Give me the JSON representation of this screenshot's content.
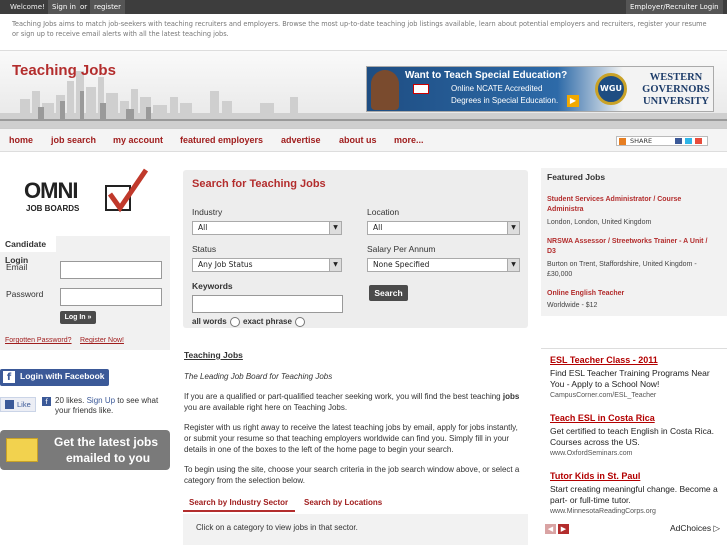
{
  "topbar": {
    "welcome": "Welcome!",
    "sign_in": "Sign in",
    "or": "or",
    "register": "register",
    "employer_login": "Employer/Recruiter Login"
  },
  "intro": "Teaching Jobs aims to match job-seekers with teaching recruiters and employers. Browse the most up-to-date teaching job listings available, learn about potential employers and recruiters, register your resume or sign up to receive email alerts with all the latest teaching jobs.",
  "header": {
    "title": "Teaching Jobs"
  },
  "banner": {
    "headline": "Want to Teach Special Education?",
    "line1": "Online NCATE Accredited",
    "line2": "Degrees in Special Education.",
    "brand1": "WESTERN",
    "brand2": "GOVERNORS",
    "brand3": "UNIVERSITY",
    "seal": "WGU"
  },
  "nav": {
    "items": [
      "home",
      "job search",
      "my account",
      "featured employers",
      "advertise",
      "about us",
      "more..."
    ]
  },
  "share": {
    "label": "SHARE"
  },
  "left": {
    "logo_text": "OMNI",
    "logo_sub": "JOB BOARDS",
    "login_title": "Candidate Login",
    "email_label": "Email",
    "password_label": "Password",
    "login_button": "Log In »",
    "forgot": "Forgotten Password?",
    "register_now": "Register Now!",
    "facebook_login": "Login with Facebook",
    "like": "Like",
    "likes_count": "20 likes.",
    "sign_up": "Sign Up",
    "likes_text": "to see what your friends like.",
    "email_promo_1": "Get the latest jobs",
    "email_promo_2": "emailed to you"
  },
  "search": {
    "title": "Search for Teaching Jobs",
    "industry_label": "Industry",
    "industry_value": "All",
    "location_label": "Location",
    "location_value": "All",
    "status_label": "Status",
    "status_value": "Any Job Status",
    "salary_label": "Salary Per Annum",
    "salary_value": "None Specified",
    "keywords_label": "Keywords",
    "keywords_value": "",
    "search_button": "Search",
    "all_words": "all words",
    "exact_phrase": "exact phrase"
  },
  "content": {
    "heading": "Teaching Jobs",
    "tagline": "The Leading Job Board for Teaching Jobs",
    "p1_a": "If you are a qualified or part-qualified teacher seeking work, you will find the best teaching ",
    "p1_bold": "jobs",
    "p1_b": " you are available right here on Teaching Jobs.",
    "p2": "Register with us right away to receive the latest teaching jobs by email, apply for jobs instantly, or submit your resume so that teaching employers worldwide can find you. Simply fill in your details in one of the boxes to the left of the home page to begin your search.",
    "p3": "To begin using the site, choose your search criteria in the job search window above, or select a category from the selection below.",
    "tab1": "Search by Industry Sector",
    "tab2": "Search by Locations",
    "category_hint": "Click on a category to view jobs in that sector."
  },
  "featured": {
    "title": "Featured Jobs",
    "jobs": [
      {
        "title": "Student Services Administrator / Course Administra",
        "location": "London, London, United Kingdom"
      },
      {
        "title": "NRSWA Assessor / Streetworks Trainer - A Unit / D3",
        "location": "Burton on Trent, Staffordshire, United Kingdom - £30,000"
      },
      {
        "title": "Online English Teacher",
        "location": "Worldwide - $12"
      }
    ]
  },
  "ads": {
    "items": [
      {
        "title": "ESL Teacher Class - 2011",
        "text": "Find ESL Teacher Training Programs Near You - Apply to a School Now!",
        "url": "CampusCorner.com/ESL_Teacher"
      },
      {
        "title": "Teach ESL in Costa Rica",
        "text": "Get certified to teach English in Costa Rica. Courses across the US.",
        "url": "www.OxfordSeminars.com"
      },
      {
        "title": "Tutor Kids in St. Paul",
        "text": "Start creating meaningful change. Become a part- or full-time tutor.",
        "url": "www.MinnesotaReadingCorps.org"
      }
    ],
    "adchoices": "AdChoices"
  }
}
